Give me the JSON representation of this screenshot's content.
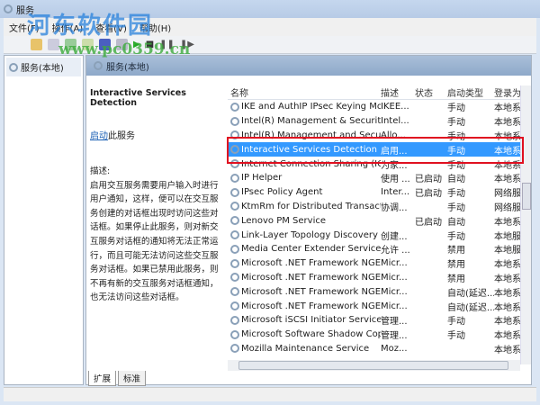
{
  "window": {
    "title": "服务"
  },
  "menu": [
    "文件(F)",
    "操作(A)",
    "查看(V)",
    "帮助(H)"
  ],
  "tree": {
    "root": "服务(本地)"
  },
  "pane": {
    "header": "服务(本地)"
  },
  "details": {
    "title": "Interactive Services Detection",
    "start_link": "启动",
    "start_suffix": "此服务",
    "desc_label": "描述:",
    "desc": "启用交互服务需要用户输入时进行用户通知，这样，便可以在交互服务创建的对话框出现时访问这些对话框。如果停止此服务，则对新交互服务对话框的通知将无法正常运行，而且可能无法访问这些交互服务对话框。如果已禁用此服务，则不再有新的交互服务对话框通知，也无法访问这些对话框。"
  },
  "columns": [
    "名称",
    "描述",
    "状态",
    "启动类型",
    "登录为"
  ],
  "services": [
    {
      "name": "IKE and AuthIP IPsec Keying Mod...",
      "desc": "IKEE...",
      "status": "",
      "startup": "手动",
      "logon": "本地系"
    },
    {
      "name": "Intel(R) Management & Security A...",
      "desc": "Intel...",
      "status": "",
      "startup": "手动",
      "logon": "本地系"
    },
    {
      "name": "Intel(R) Management and Security ...",
      "desc": "Allo...",
      "status": "",
      "startup": "手动",
      "logon": "本地系"
    },
    {
      "name": "Interactive Services Detection",
      "desc": "启用...",
      "status": "",
      "startup": "手动",
      "logon": "本地系",
      "selected": true
    },
    {
      "name": "Internet Connection Sharing (ICS)",
      "desc": "为家...",
      "status": "",
      "startup": "手动",
      "logon": "本地系"
    },
    {
      "name": "IP Helper",
      "desc": "使用 ...",
      "status": "已启动",
      "startup": "自动",
      "logon": "本地系"
    },
    {
      "name": "IPsec Policy Agent",
      "desc": "Inter...",
      "status": "已启动",
      "startup": "手动",
      "logon": "网络服"
    },
    {
      "name": "KtmRm for Distributed Transactio...",
      "desc": "协调...",
      "status": "",
      "startup": "手动",
      "logon": "网络服"
    },
    {
      "name": "Lenovo PM Service",
      "desc": "",
      "status": "已启动",
      "startup": "自动",
      "logon": "本地系"
    },
    {
      "name": "Link-Layer Topology Discovery M...",
      "desc": "创建...",
      "status": "",
      "startup": "手动",
      "logon": "本地服"
    },
    {
      "name": "Media Center Extender Service",
      "desc": "允许 ...",
      "status": "",
      "startup": "禁用",
      "logon": "本地服"
    },
    {
      "name": "Microsoft .NET Framework NGEN ...",
      "desc": "Micr...",
      "status": "",
      "startup": "禁用",
      "logon": "本地系"
    },
    {
      "name": "Microsoft .NET Framework NGEN ...",
      "desc": "Micr...",
      "status": "",
      "startup": "禁用",
      "logon": "本地系"
    },
    {
      "name": "Microsoft .NET Framework NGEN ...",
      "desc": "Micr...",
      "status": "",
      "startup": "自动(延迟...",
      "logon": "本地系"
    },
    {
      "name": "Microsoft .NET Framework NGEN ...",
      "desc": "Micr...",
      "status": "",
      "startup": "自动(延迟...",
      "logon": "本地系"
    },
    {
      "name": "Microsoft iSCSI Initiator Service",
      "desc": "管理...",
      "status": "",
      "startup": "手动",
      "logon": "本地系"
    },
    {
      "name": "Microsoft Software Shadow Copy ...",
      "desc": "管理...",
      "status": "",
      "startup": "手动",
      "logon": "本地系"
    },
    {
      "name": "Mozilla Maintenance Service",
      "desc": "Moz...",
      "status": "",
      "startup": "",
      "logon": "本地系"
    }
  ],
  "tabs": [
    "扩展",
    "标准"
  ],
  "watermark": {
    "brand": "河东软件园",
    "url": "www.pc0359.cn"
  },
  "colors": {
    "selection": "#3399ff",
    "highlight_box": "#e01020"
  }
}
